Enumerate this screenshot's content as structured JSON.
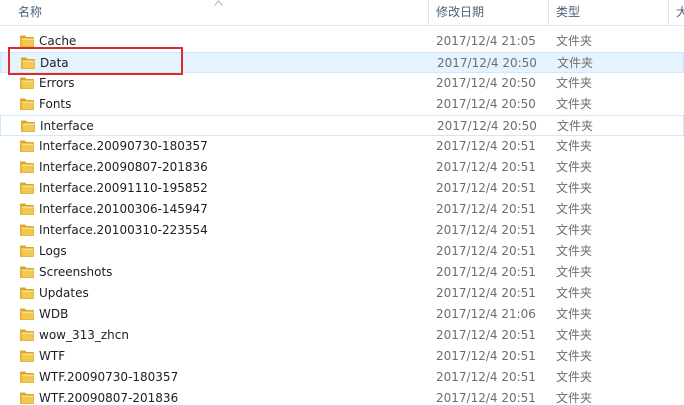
{
  "columns": {
    "name": "名称",
    "date_modified": "修改日期",
    "type": "类型",
    "size": "大"
  },
  "colors": {
    "folder": "#e8b93a",
    "hover_bg": "#e5f3ff",
    "annotation": "#e02a2a"
  },
  "rows": [
    {
      "name": "Cache",
      "date": "2017/12/4 21:05",
      "type": "文件夹"
    },
    {
      "name": "Data",
      "date": "2017/12/4 20:50",
      "type": "文件夹"
    },
    {
      "name": "Errors",
      "date": "2017/12/4 20:50",
      "type": "文件夹"
    },
    {
      "name": "Fonts",
      "date": "2017/12/4 20:50",
      "type": "文件夹"
    },
    {
      "name": "Interface",
      "date": "2017/12/4 20:50",
      "type": "文件夹"
    },
    {
      "name": "Interface.20090730-180357",
      "date": "2017/12/4 20:51",
      "type": "文件夹"
    },
    {
      "name": "Interface.20090807-201836",
      "date": "2017/12/4 20:51",
      "type": "文件夹"
    },
    {
      "name": "Interface.20091110-195852",
      "date": "2017/12/4 20:51",
      "type": "文件夹"
    },
    {
      "name": "Interface.20100306-145947",
      "date": "2017/12/4 20:51",
      "type": "文件夹"
    },
    {
      "name": "Interface.20100310-223554",
      "date": "2017/12/4 20:51",
      "type": "文件夹"
    },
    {
      "name": "Logs",
      "date": "2017/12/4 20:51",
      "type": "文件夹"
    },
    {
      "name": "Screenshots",
      "date": "2017/12/4 20:51",
      "type": "文件夹"
    },
    {
      "name": "Updates",
      "date": "2017/12/4 20:51",
      "type": "文件夹"
    },
    {
      "name": "WDB",
      "date": "2017/12/4 21:06",
      "type": "文件夹"
    },
    {
      "name": "wow_313_zhcn",
      "date": "2017/12/4 20:51",
      "type": "文件夹"
    },
    {
      "name": "WTF",
      "date": "2017/12/4 20:51",
      "type": "文件夹"
    },
    {
      "name": "WTF.20090730-180357",
      "date": "2017/12/4 20:51",
      "type": "文件夹"
    },
    {
      "name": "WTF.20090807-201836",
      "date": "2017/12/4 20:51",
      "type": "文件夹"
    }
  ]
}
